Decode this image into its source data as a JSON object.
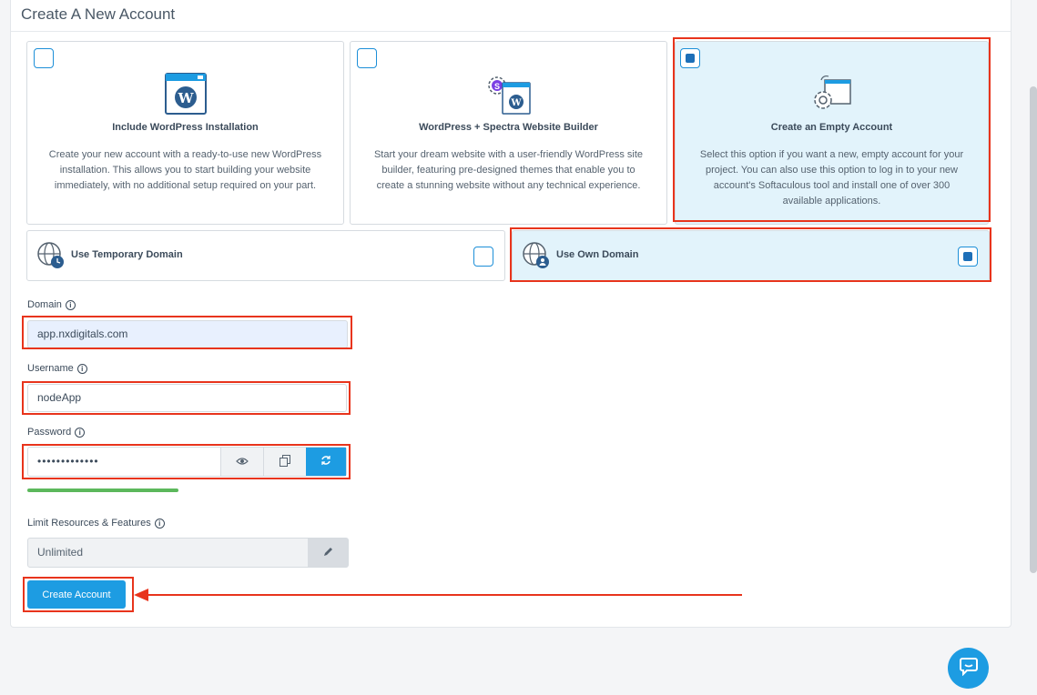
{
  "page": {
    "title": "Create A New Account"
  },
  "options": [
    {
      "title": "Include WordPress Installation",
      "description": "Create your new account with a ready-to-use new WordPress installation. This allows you to start building your website immediately, with no additional setup required on your part.",
      "selected": false,
      "icon": "wordpress-window-icon"
    },
    {
      "title": "WordPress + Spectra Website Builder",
      "description": "Start your dream website with a user-friendly WordPress site builder, featuring pre-designed themes that enable you to create a stunning website without any technical experience.",
      "selected": false,
      "icon": "spectra-builder-icon"
    },
    {
      "title": "Create an Empty Account",
      "description": "Select this option if you want a new, empty account for your project. You can also use this option to log in to your new account's Softaculous tool and install one of over 300 available applications.",
      "selected": true,
      "icon": "empty-account-gear-icon"
    }
  ],
  "domain_options": [
    {
      "label": "Use Temporary Domain",
      "selected": false,
      "icon": "globe-clock-icon"
    },
    {
      "label": "Use Own Domain",
      "selected": true,
      "icon": "globe-user-icon"
    }
  ],
  "form": {
    "domain_label": "Domain",
    "domain_value": "app.nxdigitals.com",
    "username_label": "Username",
    "username_value": "nodeApp",
    "password_label": "Password",
    "password_value": "•••••••••••••",
    "password_strength": 1.0,
    "limit_label": "Limit Resources & Features",
    "limit_value": "Unlimited"
  },
  "actions": {
    "create_label": "Create Account"
  },
  "colors": {
    "accent": "#1d9ce2",
    "selected_bg": "#e2f3fb",
    "highlight_red": "#e8341c",
    "strength_green": "#5cb85c"
  }
}
